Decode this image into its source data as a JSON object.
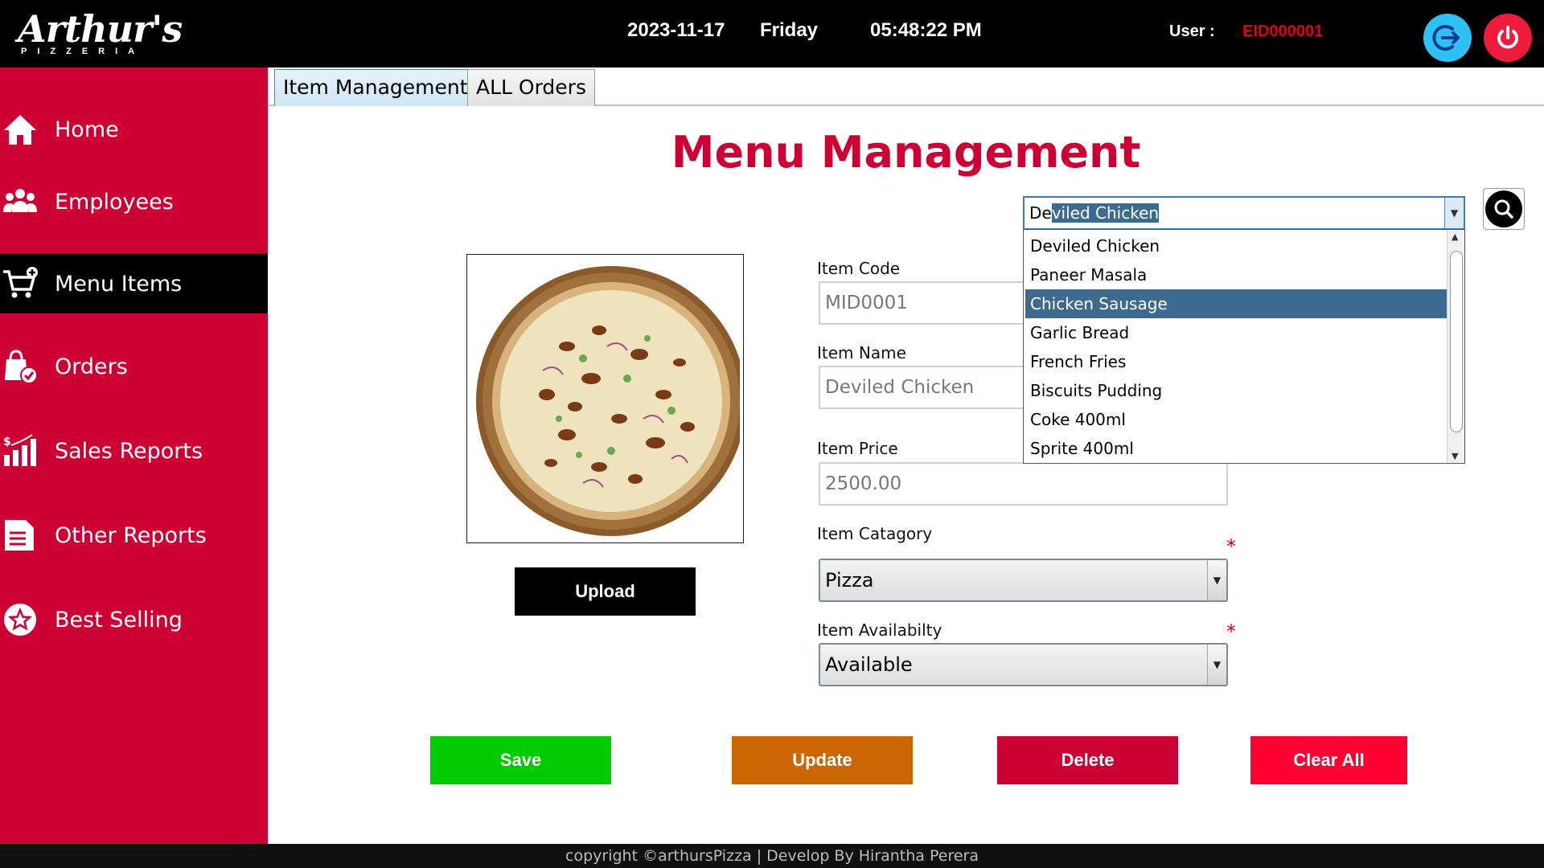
{
  "app": {
    "logo_main": "Arthur's",
    "logo_sub": "PIZZERIA"
  },
  "topbar": {
    "date": "2023-11-17",
    "day": "Friday",
    "time": "05:48:22 PM",
    "user_label": "User :",
    "user_id": "EID000001",
    "logout_icon": "logout-icon",
    "power_icon": "power-icon"
  },
  "sidebar": {
    "items": [
      {
        "label": "Home",
        "icon": "home-icon"
      },
      {
        "label": "Employees",
        "icon": "employees-icon"
      },
      {
        "label": "Menu Items",
        "icon": "cart-plus-icon",
        "active": true
      },
      {
        "label": "Orders",
        "icon": "shopping-bag-check-icon"
      },
      {
        "label": "Sales Reports",
        "icon": "bar-chart-dollar-icon"
      },
      {
        "label": "Other Reports",
        "icon": "document-icon"
      },
      {
        "label": "Best Selling",
        "icon": "star-badge-icon"
      }
    ]
  },
  "tabs": [
    {
      "label": "Item Management",
      "active": true
    },
    {
      "label": "ALL Orders",
      "active": false
    }
  ],
  "main": {
    "title": "Menu Management",
    "upload_label": "Upload",
    "search_combo": {
      "text_plain": "De",
      "text_selected": "viled Chicken",
      "options": [
        "Deviled Chicken",
        "Paneer Masala",
        "Chicken Sausage",
        "Garlic Bread",
        "French Fries",
        "Biscuits Pudding",
        "Coke 400ml",
        "Sprite 400ml"
      ],
      "highlighted": "Chicken Sausage"
    },
    "form": {
      "item_code_label": "Item Code",
      "item_code_value": "MID0001",
      "item_name_label": "Item Name",
      "item_name_value": "Deviled Chicken",
      "item_price_label": "Item Price",
      "item_price_value": "2500.00",
      "item_category_label": "Item Catagory",
      "item_category_value": "Pizza",
      "item_availability_label": "Item Availabilty",
      "item_availability_value": "Available",
      "required_mark": "*"
    },
    "buttons": {
      "save": "Save",
      "update": "Update",
      "delete": "Delete",
      "clear_all": "Clear All"
    }
  },
  "footer": {
    "text": "copyright ©arthursPizza | Develop By Hirantha Perera"
  },
  "colors": {
    "brand_red": "#cc0033",
    "save_green": "#00cc00",
    "update_orange": "#cc6600",
    "delete_red": "#cc0033",
    "clear_red": "#ff0033",
    "selection_blue": "#3d6b8f"
  }
}
